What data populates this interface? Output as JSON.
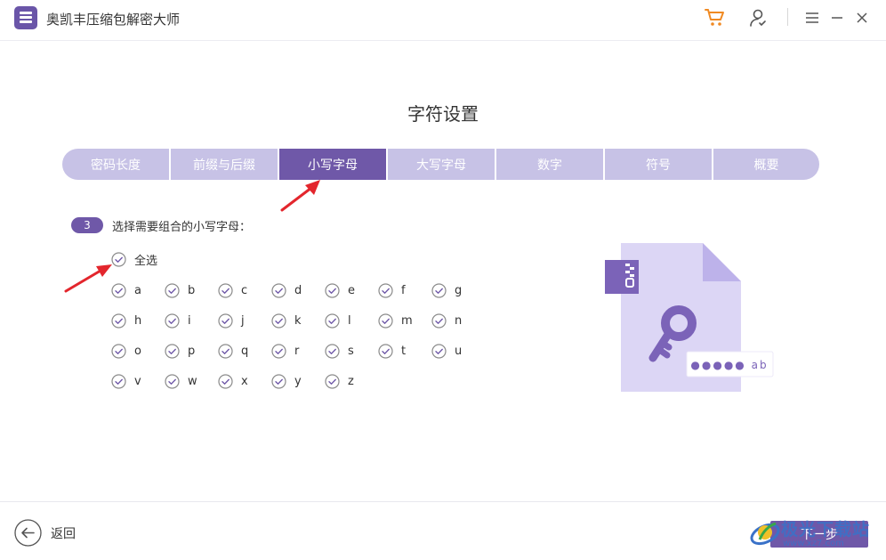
{
  "window": {
    "title": "奥凯丰压缩包解密大师",
    "icons": [
      "app-logo",
      "cart-icon",
      "user-icon",
      "menu-icon",
      "minimize-icon",
      "close-icon"
    ],
    "accent_color": "#6f58a8",
    "cart_color": "#f08a23"
  },
  "page": {
    "title": "字符设置"
  },
  "tabs": [
    {
      "label": "密码长度",
      "active": false
    },
    {
      "label": "前缀与后缀",
      "active": false
    },
    {
      "label": "小写字母",
      "active": true
    },
    {
      "label": "大写字母",
      "active": false
    },
    {
      "label": "数字",
      "active": false
    },
    {
      "label": "符号",
      "active": false
    },
    {
      "label": "概要",
      "active": false
    }
  ],
  "step": {
    "number": "3",
    "text": "选择需要组合的小写字母："
  },
  "select_all": {
    "label": "全选",
    "checked": true
  },
  "letters": [
    "a",
    "b",
    "c",
    "d",
    "e",
    "f",
    "g",
    "h",
    "i",
    "j",
    "k",
    "l",
    "m",
    "n",
    "o",
    "p",
    "q",
    "r",
    "s",
    "t",
    "u",
    "v",
    "w",
    "x",
    "y",
    "z"
  ],
  "illustration": {
    "password_hint": "●●●●● ab"
  },
  "footer": {
    "back_label": "返回",
    "next_label": "下一步"
  },
  "watermark": {
    "text": "极光下载站",
    "url": "www.xz7.com"
  }
}
